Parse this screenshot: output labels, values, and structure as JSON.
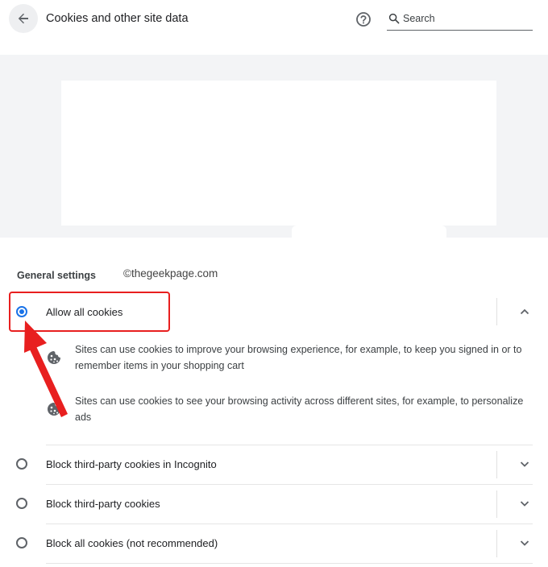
{
  "header": {
    "title": "Cookies and other site data",
    "back_icon": "arrow-left-icon",
    "help_icon": "help-circle-icon",
    "search": {
      "placeholder": "Search",
      "value": "",
      "icon": "search-icon"
    }
  },
  "general_settings": {
    "heading": "General settings",
    "watermark": "©thegeekpage.com",
    "options": [
      {
        "label": "Allow all cookies",
        "selected": true,
        "expanded": true,
        "chevron": "chevron-up-icon"
      },
      {
        "label": "Block third-party cookies in Incognito",
        "selected": false,
        "expanded": false,
        "chevron": "chevron-down-icon"
      },
      {
        "label": "Block third-party cookies",
        "selected": false,
        "expanded": false,
        "chevron": "chevron-down-icon"
      },
      {
        "label": "Block all cookies (not recommended)",
        "selected": false,
        "expanded": false,
        "chevron": "chevron-down-icon"
      }
    ],
    "allow_all_details": [
      {
        "icon": "cookie-icon",
        "text": "Sites can use cookies to improve your browsing experience, for example, to keep you signed in or to remember items in your shopping cart"
      },
      {
        "icon": "cookie-icon",
        "text": "Sites can use cookies to see your browsing activity across different sites, for example, to personalize ads"
      }
    ]
  },
  "annotation": {
    "highlight_color": "#e81f1f",
    "arrow_color": "#e81f1f"
  },
  "colors": {
    "accent": "#1a73e8",
    "band": "#f3f4f6"
  }
}
